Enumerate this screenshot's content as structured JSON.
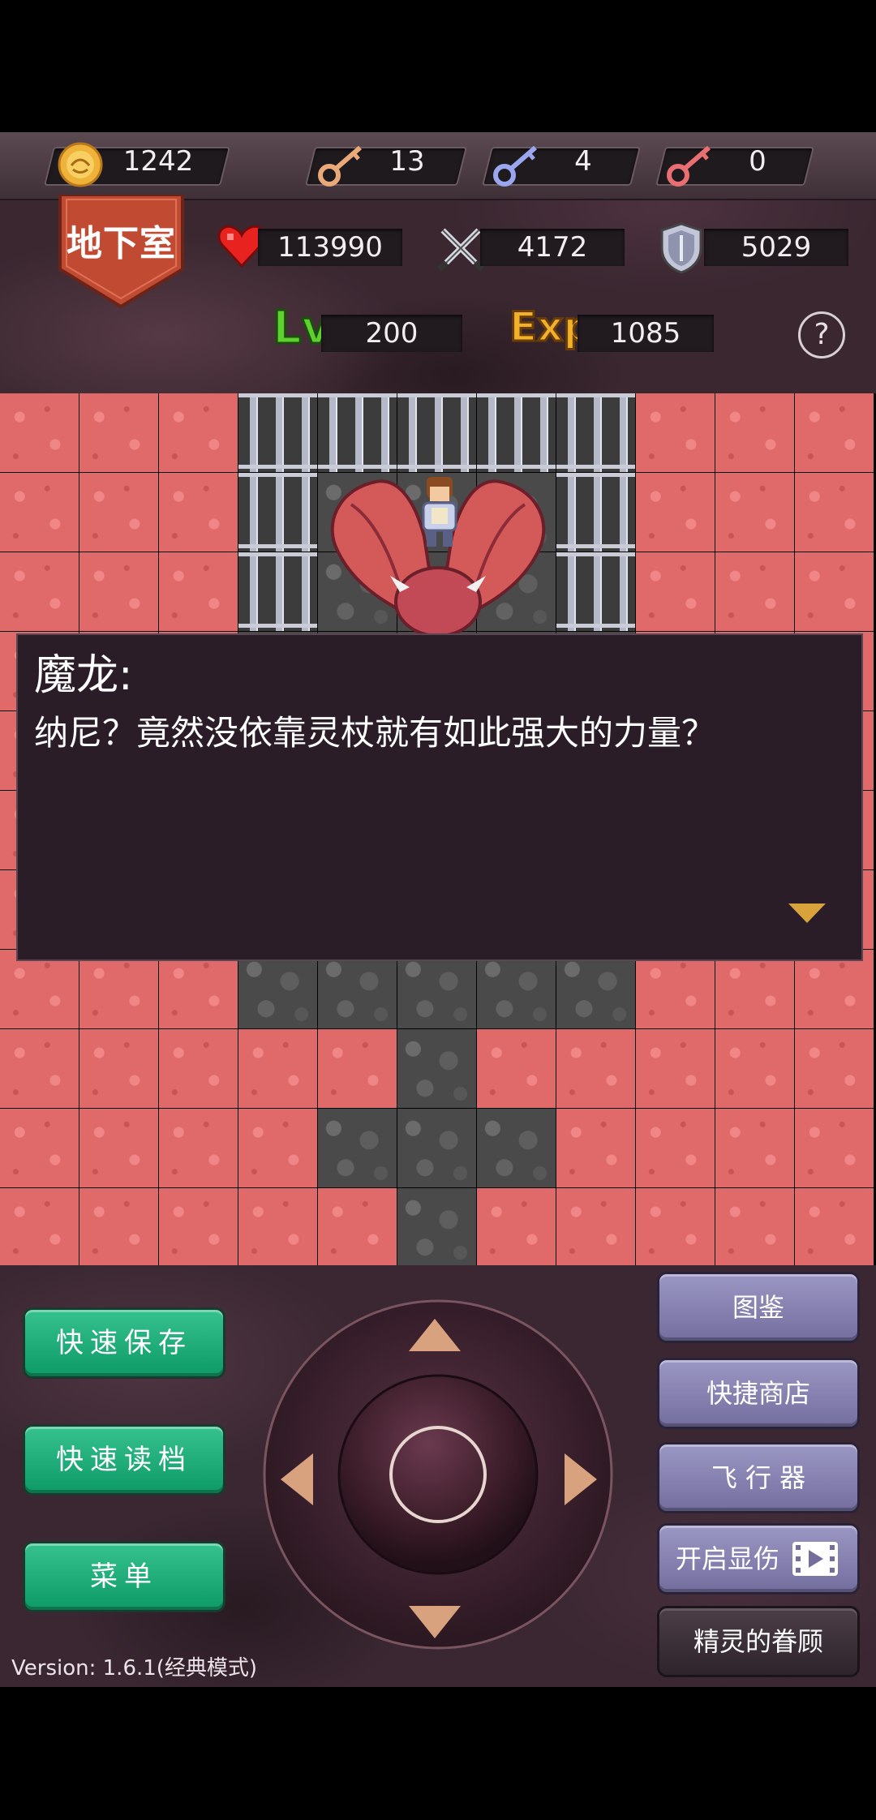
{
  "resources": {
    "gold": "1242",
    "yellow_keys": "13",
    "blue_keys": "4",
    "red_keys": "0"
  },
  "floor": {
    "label": "地下室"
  },
  "stats": {
    "hp": "113990",
    "attack": "4172",
    "defense": "5029",
    "level_label": "Lv",
    "level": "200",
    "exp_label": "Exp",
    "exp": "1085"
  },
  "help_symbol": "?",
  "dialog": {
    "speaker": "魔龙:",
    "text": "纳尼？竟然没依靠灵杖就有如此强大的力量？"
  },
  "buttons": {
    "quick_save": "快速保存",
    "quick_load": "快速读档",
    "menu": "菜单",
    "monster_book": "图鉴",
    "quick_shop": "快捷商店",
    "flyer": "飞 行 器",
    "show_damage": "开启显伤",
    "fairy_blessing": "精灵的眷顾"
  },
  "version": "Version: 1.6.1(经典模式)",
  "colors": {
    "lava": "#e06a6a",
    "stone": "#4a4a4a",
    "green_button": "#1fae78",
    "purple_button": "#8a86b4",
    "dialog_bg": "#2a1d27",
    "hud_bg": "#3a2730"
  },
  "icons": {
    "gold": "gold-coin-icon",
    "yellow_key": "yellow-key-icon",
    "blue_key": "blue-key-icon",
    "red_key": "red-key-icon",
    "hp": "heart-icon",
    "attack": "crossed-swords-icon",
    "defense": "shield-icon"
  }
}
